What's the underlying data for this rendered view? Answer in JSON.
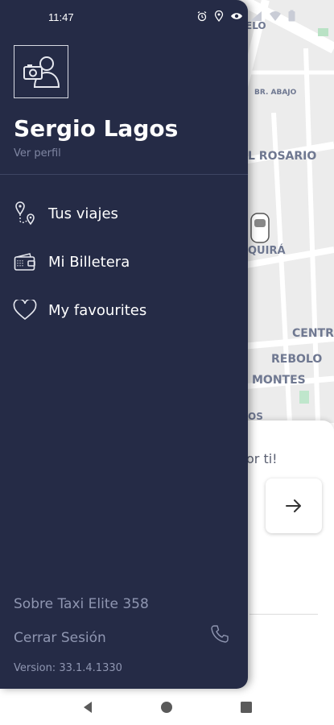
{
  "status_bar": {
    "time": "11:47",
    "icons": [
      "alarm-icon",
      "location-icon",
      "eye-icon",
      "wifi-icon",
      "signal-icon",
      "battery-icon"
    ]
  },
  "drawer": {
    "user_name": "Sergio Lagos",
    "view_profile": "Ver perfil",
    "menu": [
      {
        "label": "Tus viajes",
        "icon": "route-pin-icon"
      },
      {
        "label": "Mi Billetera",
        "icon": "wallet-icon"
      },
      {
        "label": "My favourites",
        "icon": "heart-icon"
      }
    ],
    "footer": {
      "about": "Sobre Taxi Elite 358",
      "logout": "Cerrar Sesión",
      "version_label": "Version:",
      "version_number": "33.1.4.1330"
    }
  },
  "map": {
    "labels": [
      "ELO",
      "BR. ABAJO",
      "L ROSARIO",
      "QUIRÁ",
      "CENTRO",
      "REBOLO",
      "MONTES",
      "OS"
    ]
  },
  "bottom_sheet": {
    "hint": "or ti!"
  },
  "colors": {
    "drawer_bg": "#252b46",
    "text_primary": "#ffffff",
    "text_muted": "#8f96b1"
  }
}
